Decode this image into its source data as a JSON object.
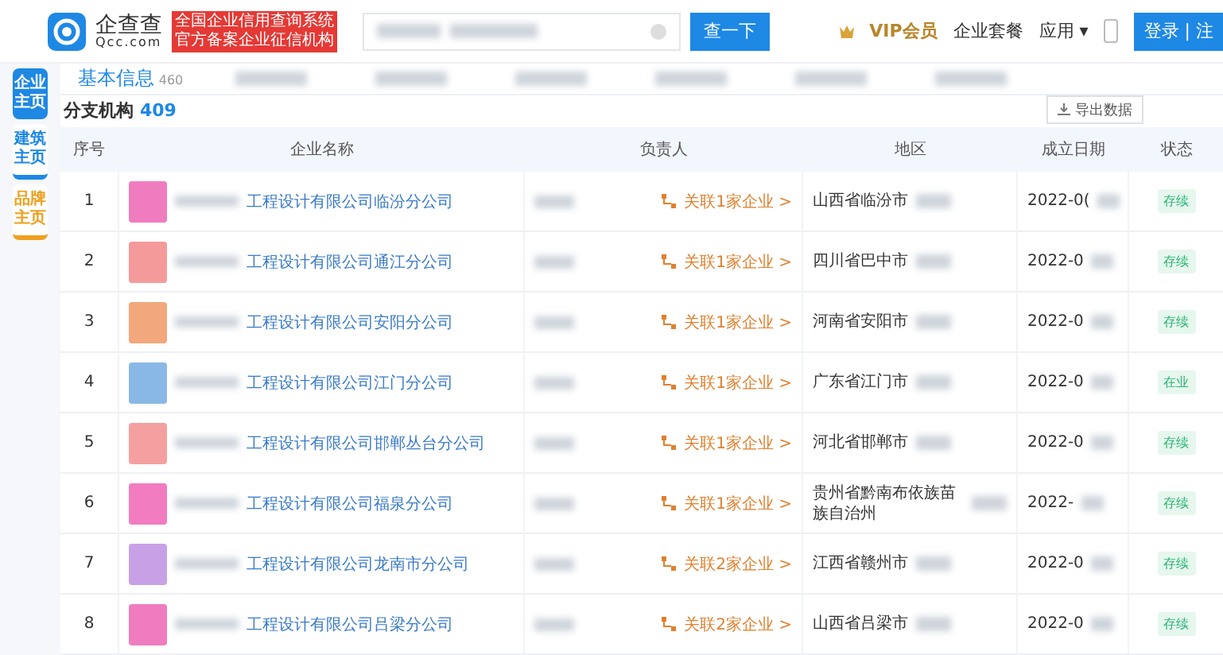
{
  "header": {
    "logo_name": "企查查",
    "logo_domain": "Qcc.com",
    "badge_lines": [
      "全国企业信用查询系统",
      "官方备案企业征信机构"
    ],
    "search_button": "查一下",
    "nav": [
      {
        "kind": "vip",
        "label": "VIP会员"
      },
      {
        "kind": "link",
        "label": "企业套餐"
      },
      {
        "kind": "menu",
        "label": "应用 ▾"
      },
      {
        "kind": "phone"
      }
    ],
    "login": "登录 | 注"
  },
  "side_tabs": [
    {
      "label": "企业主页",
      "selected": true,
      "color": "#1e88e5"
    },
    {
      "label": "建筑主页",
      "selected": false,
      "color": "#1e88e5"
    },
    {
      "label": "品牌主页",
      "selected": false,
      "color": "#f0a020"
    }
  ],
  "tabs": [
    {
      "label": "基本信息",
      "count": "460",
      "selected": true
    }
  ],
  "section": {
    "title": "分支机构",
    "count": "409",
    "export": "导出数据"
  },
  "table": {
    "columns": [
      "序号",
      "企业名称",
      "负责人",
      "地区",
      "成立日期",
      "状态"
    ],
    "rows": [
      {
        "index": "1",
        "color": "#f07cc0",
        "name": "工程设计有限公司临汾分公司",
        "link": "关联1家企业 >",
        "region": "山西省临汾市",
        "date": "2022-0(",
        "status": "存续"
      },
      {
        "index": "2",
        "color": "#f59a9a",
        "name": "工程设计有限公司通江分公司",
        "link": "关联1家企业 >",
        "region": "四川省巴中市",
        "date": "2022-0",
        "status": "存续"
      },
      {
        "index": "3",
        "color": "#f2a87c",
        "name": "工程设计有限公司安阳分公司",
        "link": "关联1家企业 >",
        "region": "河南省安阳市",
        "date": "2022-0",
        "status": "存续"
      },
      {
        "index": "4",
        "color": "#8ab8e6",
        "name": "工程设计有限公司江门分公司",
        "link": "关联1家企业 >",
        "region": "广东省江门市",
        "date": "2022-0",
        "status": "在业"
      },
      {
        "index": "5",
        "color": "#f5a0a0",
        "name": "工程设计有限公司邯郸丛台分公司",
        "link": "关联1家企业 >",
        "region": "河北省邯郸市",
        "date": "2022-0",
        "status": "存续"
      },
      {
        "index": "6",
        "color": "#f27cc0",
        "name": "工程设计有限公司福泉分公司",
        "link": "关联1家企业 >",
        "region": "贵州省黔南布依族苗族自治州",
        "date": "2022-",
        "status": "存续"
      },
      {
        "index": "7",
        "color": "#c8a0e6",
        "name": "工程设计有限公司龙南市分公司",
        "link": "关联2家企业 >",
        "region": "江西省赣州市",
        "date": "2022-0",
        "status": "存续"
      },
      {
        "index": "8",
        "color": "#f07cc0",
        "name": "工程设计有限公司吕梁分公司",
        "link": "关联2家企业 >",
        "region": "山西省吕梁市",
        "date": "2022-0",
        "status": "存续"
      }
    ]
  }
}
